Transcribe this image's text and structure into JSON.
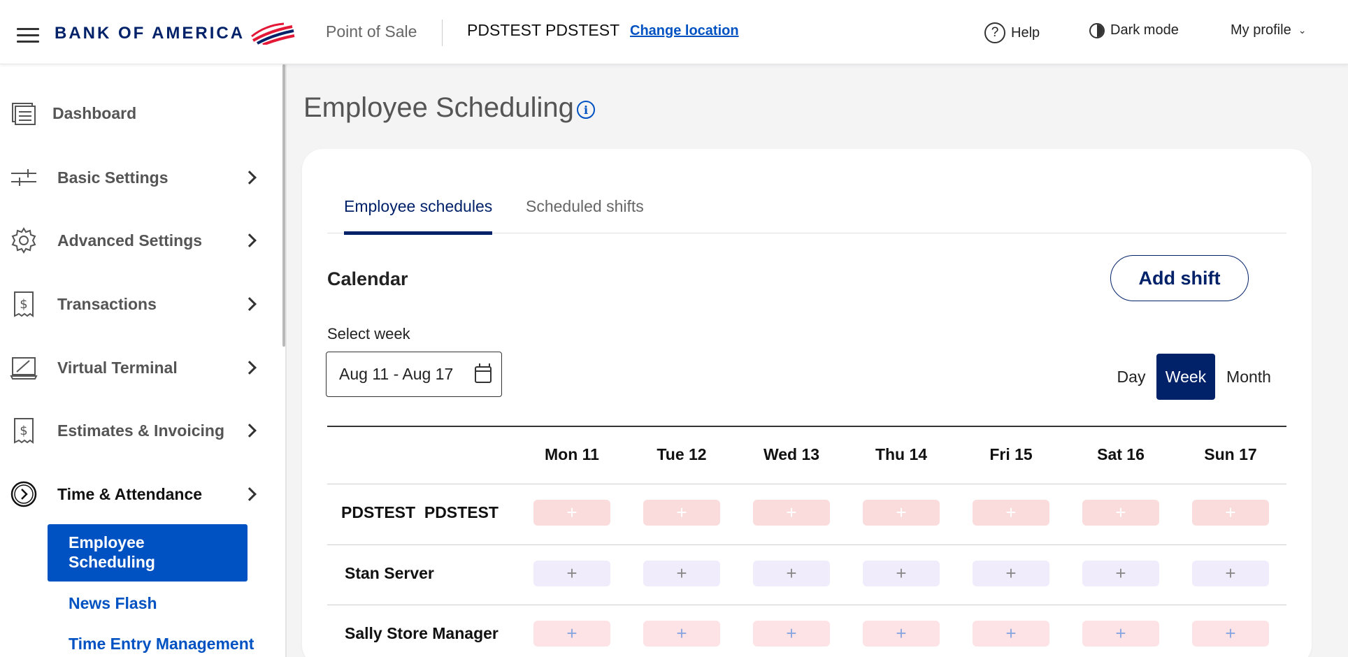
{
  "header": {
    "brand": "BANK OF AMERICA",
    "app_name": "Point of Sale",
    "location": "PDSTEST PDSTEST",
    "change_location": "Change location",
    "help": "Help",
    "dark_mode": "Dark mode",
    "profile": "My profile"
  },
  "sidebar": {
    "items": [
      {
        "label": "Dashboard",
        "icon": "dashboard-icon"
      },
      {
        "label": "Basic Settings",
        "icon": "sliders-icon"
      },
      {
        "label": "Advanced Settings",
        "icon": "gear-icon"
      },
      {
        "label": "Transactions",
        "icon": "receipt-dollar-icon"
      },
      {
        "label": "Virtual Terminal",
        "icon": "terminal-icon"
      },
      {
        "label": "Estimates & Invoicing",
        "icon": "invoice-dollar-icon"
      },
      {
        "label": "Time & Attendance",
        "icon": "clock-icon"
      }
    ],
    "sub_items": [
      {
        "label": "Employee Scheduling",
        "active": true
      },
      {
        "label": "News Flash"
      },
      {
        "label": "Time Entry Management"
      }
    ]
  },
  "main": {
    "title": "Employee Scheduling",
    "tabs": [
      {
        "label": "Employee schedules",
        "active": true
      },
      {
        "label": "Scheduled shifts"
      }
    ],
    "calendar_title": "Calendar",
    "add_shift": "Add shift",
    "select_week_label": "Select week",
    "week_value": "Aug 11 - Aug 17",
    "views": {
      "day": "Day",
      "week": "Week",
      "month": "Month",
      "selected": "Week"
    },
    "days": [
      "Mon 11",
      "Tue 12",
      "Wed 13",
      "Thu 14",
      "Fri 15",
      "Sat 16",
      "Sun 17"
    ],
    "employees": [
      {
        "name": "PDSTEST  PDSTEST",
        "slot_color": "#fbdcdc",
        "plus_color": "#ffffff"
      },
      {
        "name": "Stan Server",
        "slot_color": "#f1ecfb",
        "plus_color": "#8a8a8a"
      },
      {
        "name": "Sally Store Manager",
        "slot_color": "#fde3e6",
        "plus_color": "#8aa6e0"
      }
    ],
    "slot_symbol": "+"
  },
  "colors": {
    "brand_navy": "#012169",
    "link_blue": "#0052c2",
    "page_bg": "#f4f4f5"
  }
}
